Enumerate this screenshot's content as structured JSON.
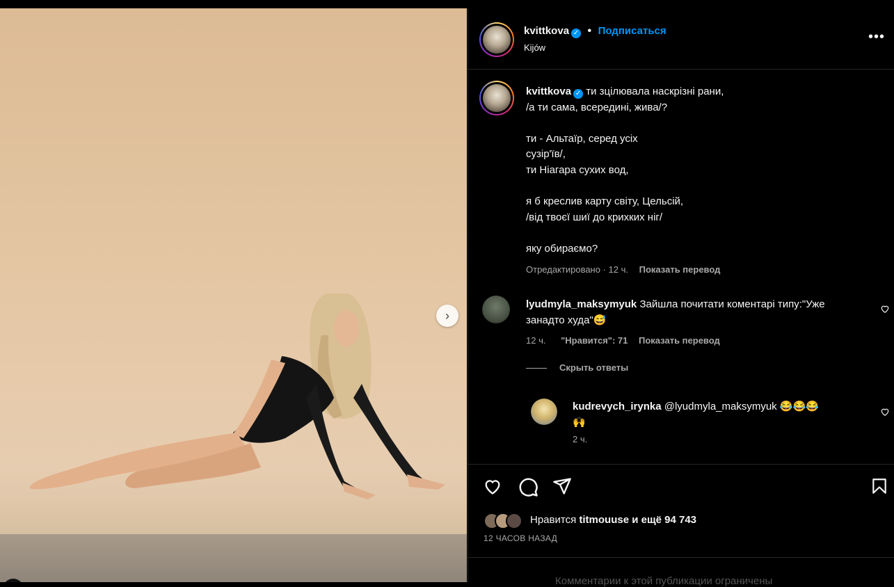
{
  "post": {
    "username": "kvittkova",
    "follow_label": "Подписаться",
    "separator": "•",
    "location": "Kijów",
    "more_label": "•••",
    "caption_lines": [
      "ти зцілювала наскрізні рани,",
      "/а ти сама, всередині, жива/?",
      "",
      "ти - Альтаїр, серед усіх",
      "сузір'їв/,",
      "ти Ніагара сухих вод,",
      "",
      "я б креслив карту світу, Цельсій,",
      "/від твоєї шиї до крихких ніг/",
      "",
      "яку обираємо?"
    ],
    "edited_label": "Отредактировано",
    "caption_time": "12 ч.",
    "translate_label": "Показать перевод"
  },
  "comments": [
    {
      "username": "lyudmyla_maksymyuk",
      "text_line1": "Зайшла почитати коментарі типу:\"Уже",
      "text_line2": "занадто худа\"😅",
      "time": "12 ч.",
      "likes": "\"Нравится\": 71",
      "translate": "Показать перевод",
      "hide_replies": "Скрыть ответы"
    },
    {
      "username": "kudrevych_irynka",
      "text_line1": "@lyudmyla_maksymyuk 😂😂😂",
      "text_line2": "🙌",
      "time": "2 ч."
    }
  ],
  "footer": {
    "likes_prefix": "Нравится",
    "likes_user": "titmouuse",
    "likes_mid": "и ещё",
    "likes_count": "94 743",
    "timestamp": "12 ЧАСОВ НАЗАД",
    "faded_text": "Комментарии к этой публикации ограничены"
  },
  "photo": {
    "next_icon": "chevron-right-icon"
  },
  "colors": {
    "accent": "#0095f6",
    "secondary_text": "#a8a8a8",
    "border": "#262626"
  }
}
